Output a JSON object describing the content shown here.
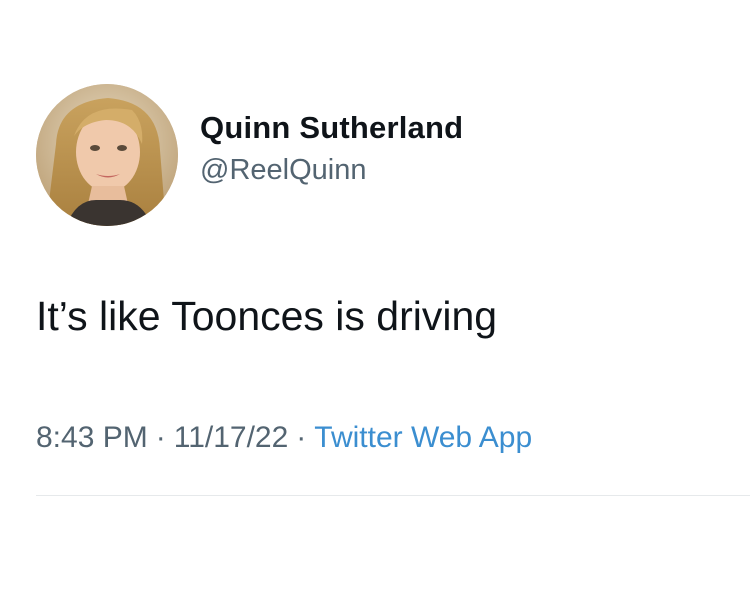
{
  "author": {
    "display_name": "Quinn Sutherland",
    "handle": "@ReelQuinn"
  },
  "tweet": {
    "text": "It’s like Toonces is driving"
  },
  "meta": {
    "time": "8:43 PM",
    "date": "11/17/22",
    "separator": "·",
    "source": "Twitter Web App"
  },
  "colors": {
    "text_primary": "#0f1419",
    "text_secondary": "#536471",
    "link": "#3b8ed0",
    "divider": "#e6e9eb"
  }
}
